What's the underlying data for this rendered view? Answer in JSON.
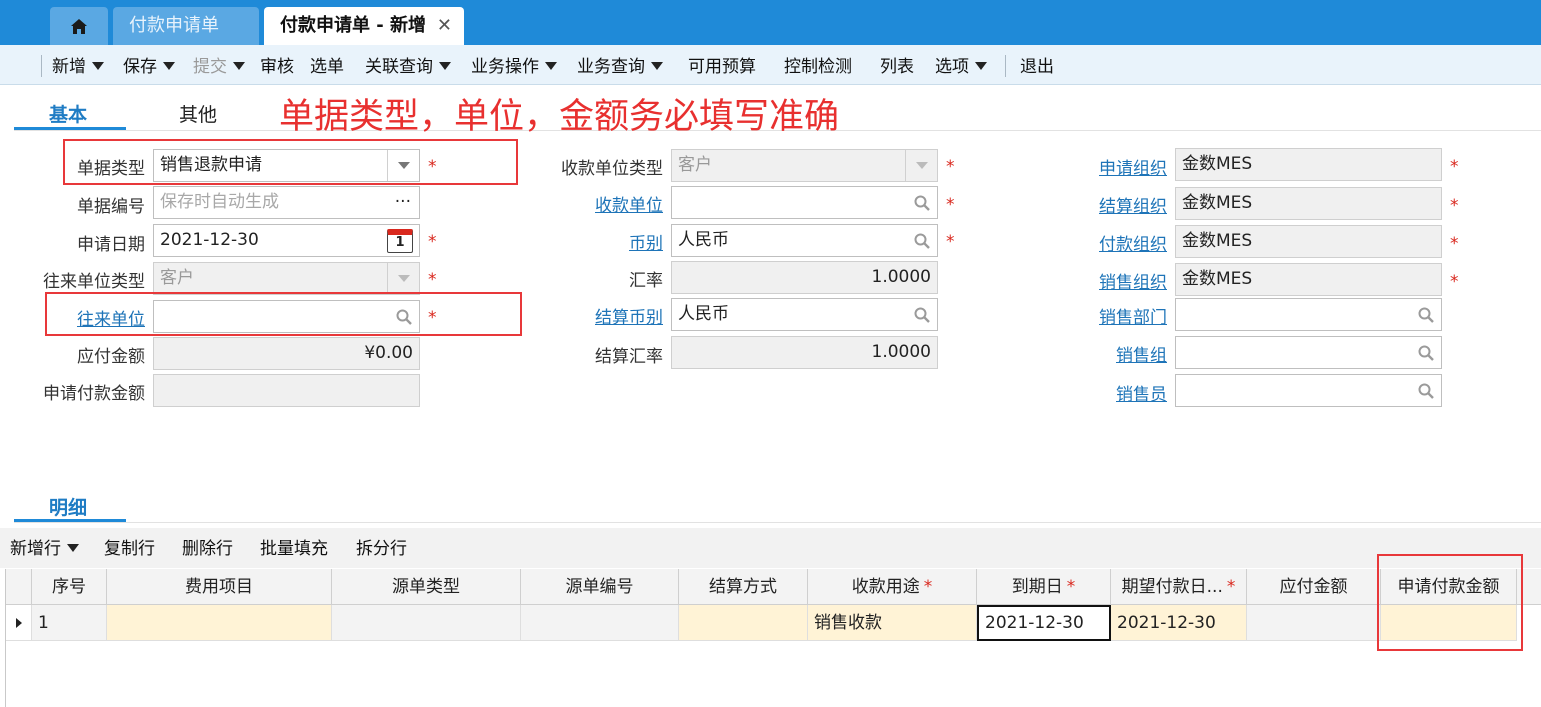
{
  "tabs": {
    "home_icon": "home-icon",
    "list": "付款申请单",
    "active": "付款申请单 - 新增",
    "close": "✕"
  },
  "toolbar": {
    "new": "新增",
    "save": "保存",
    "submit": "提交",
    "audit": "审核",
    "pick": "选单",
    "related_query": "关联查询",
    "business_ops": "业务操作",
    "business_query": "业务查询",
    "available_budget": "可用预算",
    "control_check": "控制检测",
    "list": "列表",
    "options": "选项",
    "exit": "退出"
  },
  "sections": {
    "basic": "基本",
    "other": "其他",
    "detail": "明细"
  },
  "notice": "单据类型，单位，金额务必填写准确",
  "required_mark": "*",
  "form": {
    "bill_type_label": "单据类型",
    "bill_type_value": "销售退款申请",
    "bill_no_label": "单据编号",
    "bill_no_placeholder": "保存时自动生成",
    "bill_no_more": "···",
    "apply_date_label": "申请日期",
    "apply_date_value": "2021-12-30",
    "calendar_day": "1",
    "contact_type_label": "往来单位类型",
    "contact_type_value": "客户",
    "contact_unit_label": "往来单位",
    "contact_unit_value": "",
    "payable_label": "应付金额",
    "payable_value": "¥0.00",
    "apply_pay_label": "申请付款金额",
    "apply_pay_value": "",
    "payee_type_label": "收款单位类型",
    "payee_type_value": "客户",
    "payee_unit_label": "收款单位",
    "payee_unit_value": "",
    "currency_label": "币别",
    "currency_value": "人民币",
    "rate_label": "汇率",
    "rate_value": "1.0000",
    "settle_currency_label": "结算币别",
    "settle_currency_value": "人民币",
    "settle_rate_label": "结算汇率",
    "settle_rate_value": "1.0000",
    "apply_org_label": "申请组织",
    "apply_org_value": "金数MES",
    "settle_org_label": "结算组织",
    "settle_org_value": "金数MES",
    "pay_org_label": "付款组织",
    "pay_org_value": "金数MES",
    "sales_org_label": "销售组织",
    "sales_org_value": "金数MES",
    "sales_dept_label": "销售部门",
    "sales_dept_value": "",
    "sales_group_label": "销售组",
    "sales_group_value": "",
    "salesman_label": "销售员",
    "salesman_value": ""
  },
  "detail_toolbar": {
    "add_row": "新增行",
    "copy_row": "复制行",
    "delete_row": "删除行",
    "batch_fill": "批量填充",
    "split_row": "拆分行"
  },
  "grid": {
    "headers": [
      "序号",
      "费用项目",
      "源单类型",
      "源单编号",
      "结算方式",
      "收款用途",
      "到期日",
      "期望付款日...",
      "应付金额",
      "申请付款金额"
    ],
    "rows": [
      {
        "seq": "1",
        "expense_item": "",
        "source_type": "",
        "source_no": "",
        "settle_method": "",
        "purpose": "销售收款",
        "due_date": "2021-12-30",
        "expected_date": "2021-12-30",
        "payable": "",
        "apply_amount": ""
      }
    ]
  },
  "colors": {
    "accent": "#1f8ad8",
    "annotation": "#e8302f",
    "required": "#d9281e",
    "link": "#1e74b8"
  }
}
